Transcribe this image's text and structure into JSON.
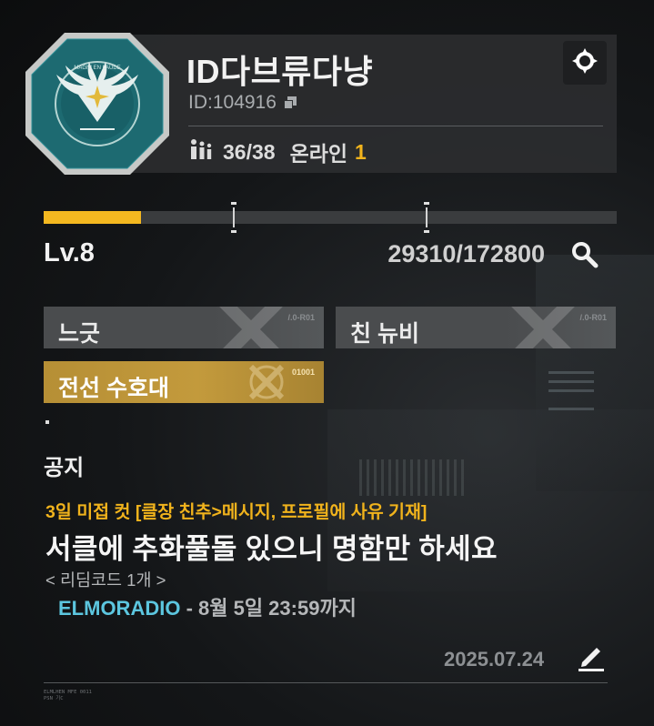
{
  "circle": {
    "name": "ID다브류다냥",
    "id_label": "ID:",
    "id_value": "104916",
    "members": "36/38",
    "online_label": "온라인",
    "online_count": "1",
    "emblem_text": "MAGNI EN LAUDE"
  },
  "level": {
    "label": "Lv.8",
    "xp": "29310/172800",
    "progress": 0.17
  },
  "tags": [
    {
      "label": "느긋",
      "code": "/.0-R01",
      "style": "gray"
    },
    {
      "label": "친 뉴비",
      "code": "/.0-R01",
      "style": "gray"
    },
    {
      "label": "전선 수호대",
      "code": "01001",
      "style": "gold"
    }
  ],
  "notice": {
    "title": "공지",
    "line1": "3일 미접 컷 [클장 친추>메시지, 프로필에 사유 기재]",
    "line2": "서클에 추화풀돌 있으니 명함만 하세요",
    "line3": "< 리딤코드 1개 >",
    "redeem_code": "ELMORADIO",
    "line4_rest": " - 8월 5일 23:59까지",
    "date": "2025.07.24"
  },
  "footer": {
    "line1": "ELMLHEN MFE 0011",
    "line2": "PSN 기C"
  },
  "colors": {
    "accent_gold": "#f1b31c",
    "code_blue": "#5cc6df",
    "badge_teal": "#1f6f76"
  },
  "icons": [
    "settings-icon",
    "copy-icon",
    "members-icon",
    "search-icon",
    "edit-icon"
  ]
}
